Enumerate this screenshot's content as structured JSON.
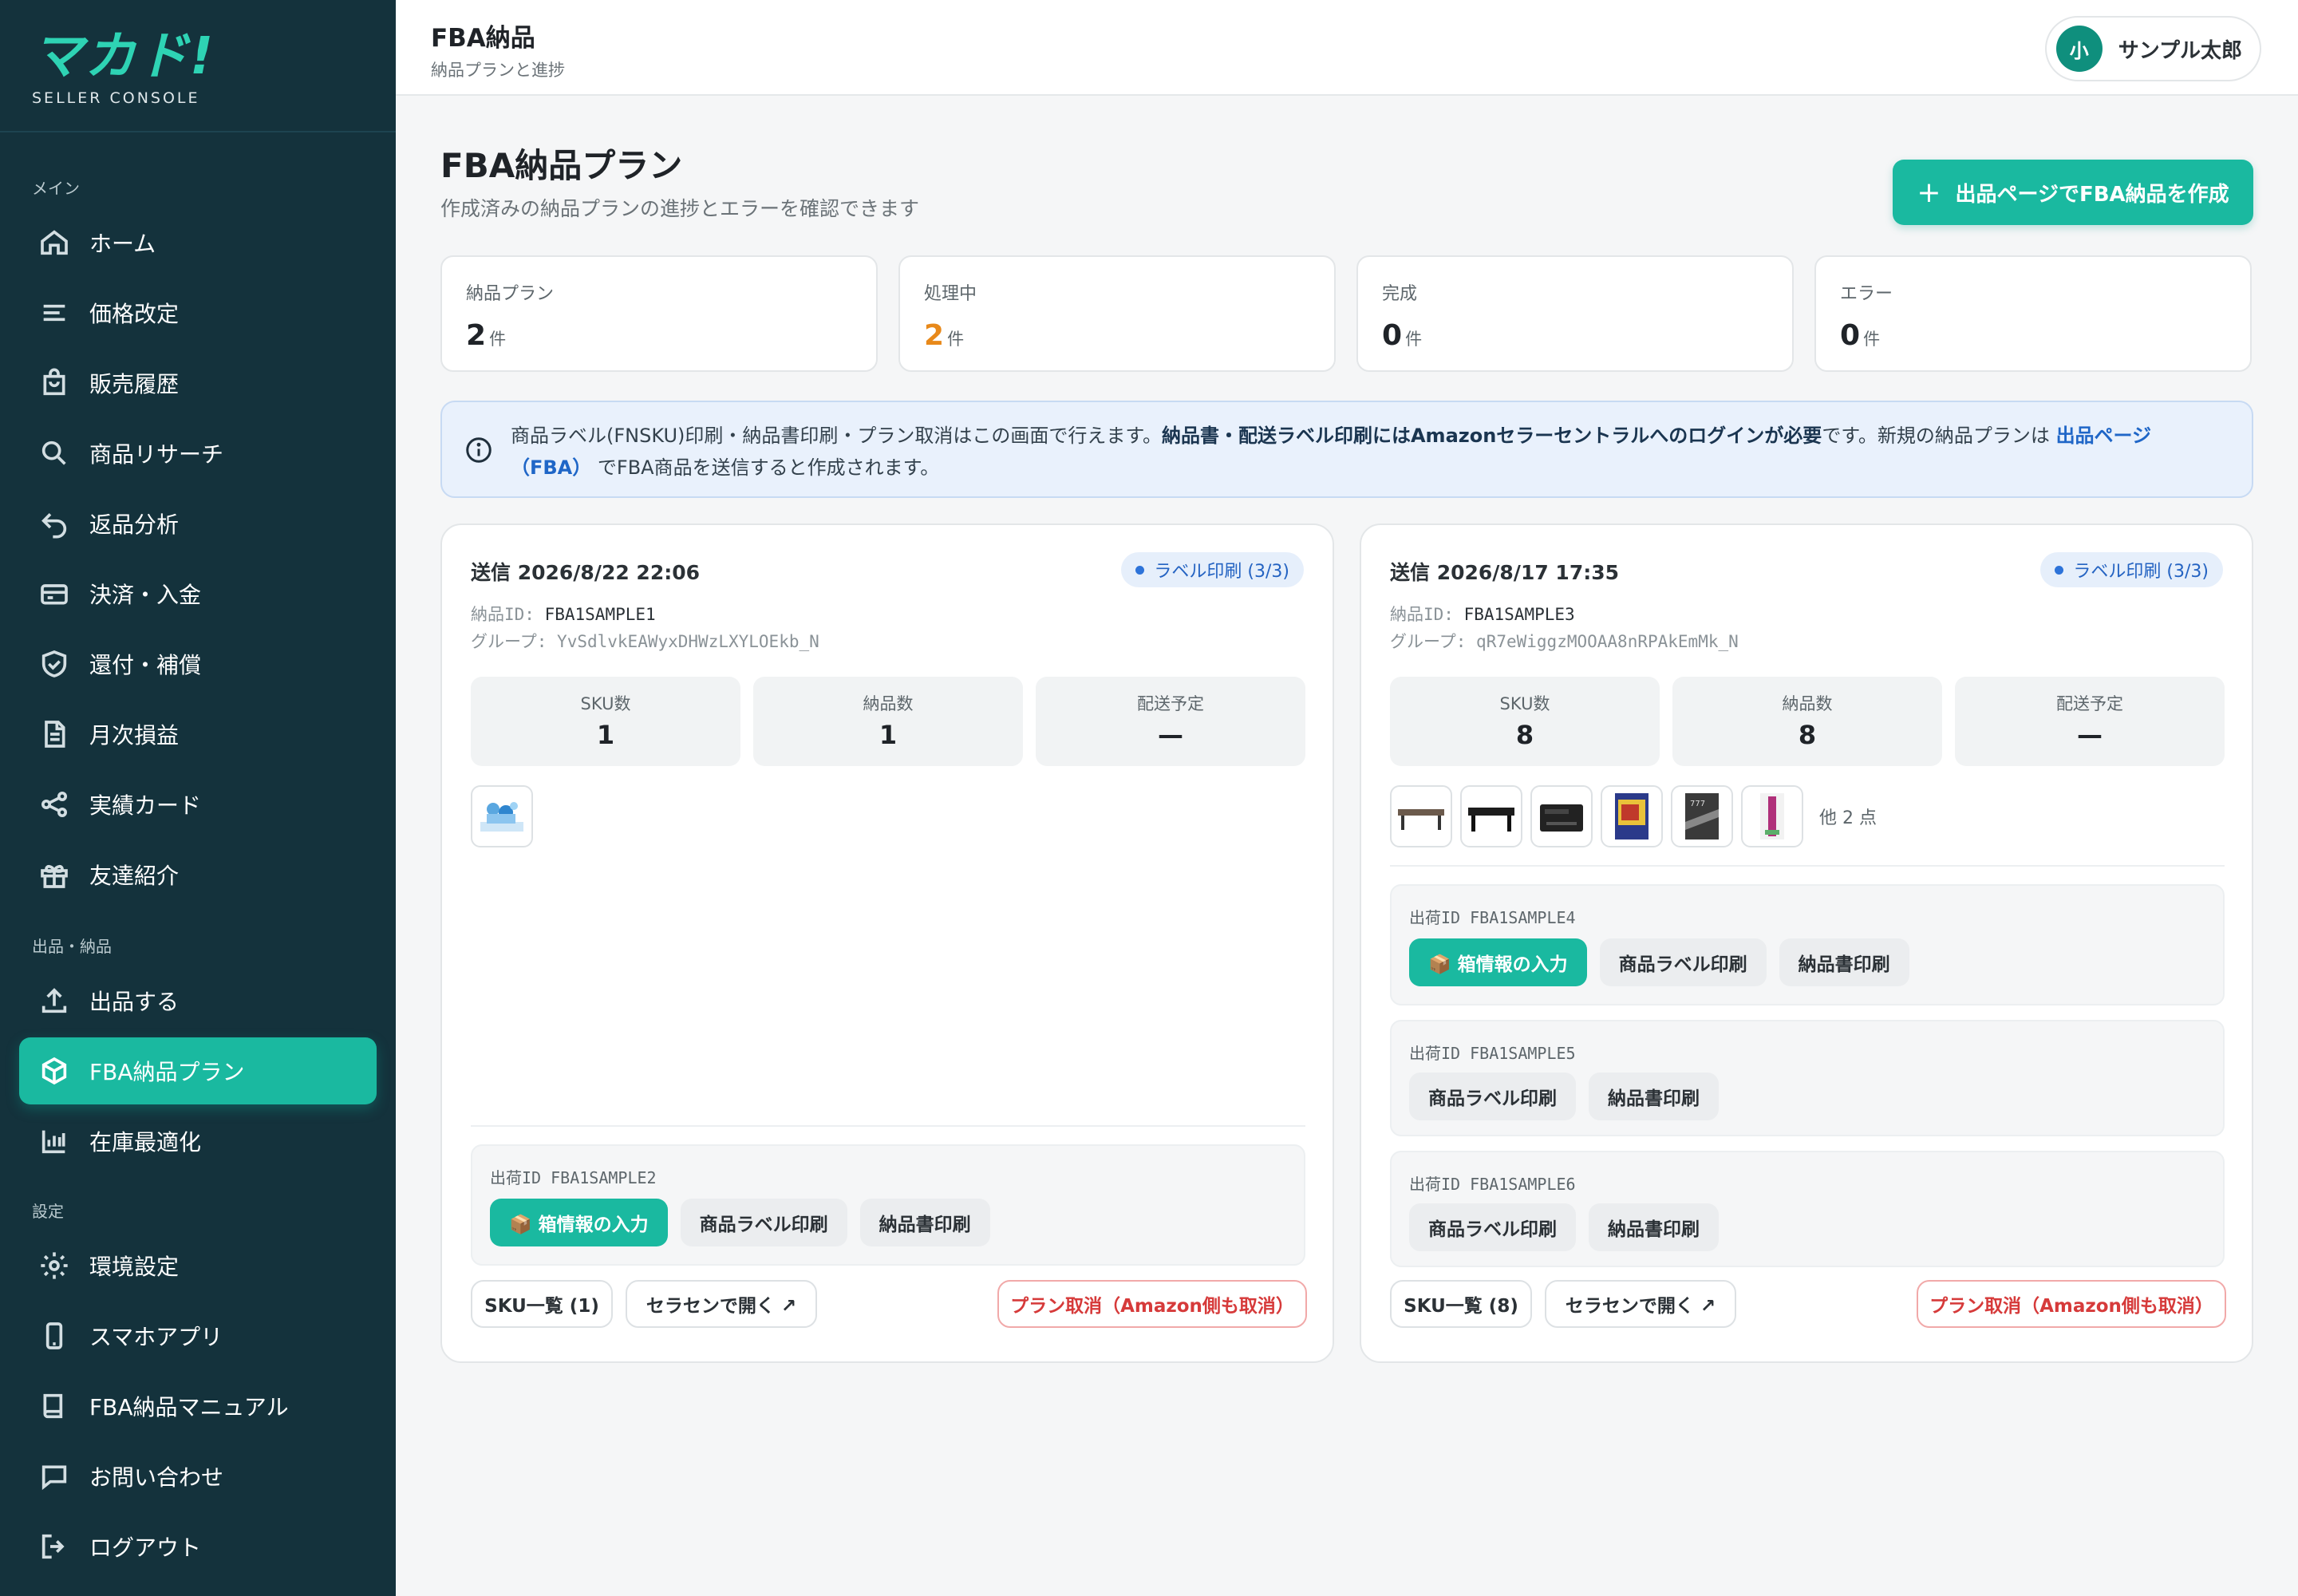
{
  "brand": {
    "logo_text": "マカド!",
    "logo_sub": "SELLER CONSOLE"
  },
  "sidebar": {
    "sections": {
      "main": "メイン",
      "listing": "出品・納品",
      "settings": "設定"
    },
    "items": [
      {
        "label": "ホーム",
        "icon": "home-icon"
      },
      {
        "label": "価格改定",
        "icon": "list-icon"
      },
      {
        "label": "販売履歴",
        "icon": "bag-icon"
      },
      {
        "label": "商品リサーチ",
        "icon": "search-icon"
      },
      {
        "label": "返品分析",
        "icon": "return-icon"
      },
      {
        "label": "決済・入金",
        "icon": "card-icon"
      },
      {
        "label": "還付・補償",
        "icon": "shield-icon"
      },
      {
        "label": "月次損益",
        "icon": "document-icon"
      },
      {
        "label": "実績カード",
        "icon": "share-icon"
      },
      {
        "label": "友達紹介",
        "icon": "gift-icon"
      },
      {
        "label": "出品する",
        "icon": "upload-icon"
      },
      {
        "label": "FBA納品プラン",
        "icon": "box-icon"
      },
      {
        "label": "在庫最適化",
        "icon": "bar-chart-icon"
      },
      {
        "label": "環境設定",
        "icon": "gear-icon"
      },
      {
        "label": "スマホアプリ",
        "icon": "phone-icon"
      },
      {
        "label": "FBA納品マニュアル",
        "icon": "book-icon"
      },
      {
        "label": "お問い合わせ",
        "icon": "chat-icon"
      },
      {
        "label": "ログアウト",
        "icon": "logout-icon"
      }
    ]
  },
  "header": {
    "title": "FBA納品",
    "subtitle": "納品プランと進捗",
    "user_initial": "小",
    "user_name": "サンプル太郎"
  },
  "page": {
    "title": "FBA納品プラン",
    "subtitle": "作成済みの納品プランの進捗とエラーを確認できます",
    "create_button": "出品ページでFBA納品を作成"
  },
  "stats": [
    {
      "label": "納品プラン",
      "value": "2",
      "unit": "件"
    },
    {
      "label": "処理中",
      "value": "2",
      "unit": "件"
    },
    {
      "label": "完成",
      "value": "0",
      "unit": "件"
    },
    {
      "label": "エラー",
      "value": "0",
      "unit": "件"
    }
  ],
  "info": {
    "text1": "商品ラベル(FNSKU)印刷・納品書印刷・プラン取消はこの画面で行えます。",
    "bold": "納品書・配送ラベル印刷にはAmazonセラーセントラルへのログインが必要",
    "text2": "です。新規の納品プランは",
    "link": "出品ページ（FBA）",
    "text3": "でFBA商品を送信すると作成されます。"
  },
  "colors": {
    "accent": "#1ab9a0",
    "sidebar_bg": "#14323c",
    "processing": "#e8891a",
    "danger": "#d63a3a",
    "link": "#1f66c7"
  },
  "plans": [
    {
      "sent": "送信 2026/8/22 22:06",
      "badge": "ラベル印刷 (3/3)",
      "id_label": "納品ID:",
      "id": "FBA1SAMPLE1",
      "group_label": "グループ:",
      "group": "YvSdlvkEAWyxDHWzLXYLOEkb_N",
      "sku_label": "SKU数",
      "sku": "1",
      "qty_label": "納品数",
      "qty": "1",
      "ship_label": "配送予定",
      "ship": "—",
      "more": "",
      "shipments": [
        {
          "id_label": "出荷ID",
          "id": "FBA1SAMPLE2",
          "box": "📦 箱情報の入力",
          "label_btn": "商品ラベル印刷",
          "doc_btn": "納品書印刷"
        }
      ],
      "sku_list": "SKU一覧 (1)",
      "open": "セラセンで開く ↗",
      "cancel": "プラン取消（Amazon側も取消）"
    },
    {
      "sent": "送信 2026/8/17 17:35",
      "badge": "ラベル印刷 (3/3)",
      "id_label": "納品ID:",
      "id": "FBA1SAMPLE3",
      "group_label": "グループ:",
      "group": "qR7eWiggzMOOAA8nRPAkEmMk_N",
      "sku_label": "SKU数",
      "sku": "8",
      "qty_label": "納品数",
      "qty": "8",
      "ship_label": "配送予定",
      "ship": "—",
      "more": "他 2 点",
      "shipments": [
        {
          "id_label": "出荷ID",
          "id": "FBA1SAMPLE4",
          "box": "📦 箱情報の入力",
          "label_btn": "商品ラベル印刷",
          "doc_btn": "納品書印刷"
        },
        {
          "id_label": "出荷ID",
          "id": "FBA1SAMPLE5",
          "label_btn": "商品ラベル印刷",
          "doc_btn": "納品書印刷"
        },
        {
          "id_label": "出荷ID",
          "id": "FBA1SAMPLE6",
          "label_btn": "商品ラベル印刷",
          "doc_btn": "納品書印刷"
        }
      ],
      "sku_list": "SKU一覧 (8)",
      "open": "セラセンで開く ↗",
      "cancel": "プラン取消（Amazon側も取消）"
    }
  ]
}
